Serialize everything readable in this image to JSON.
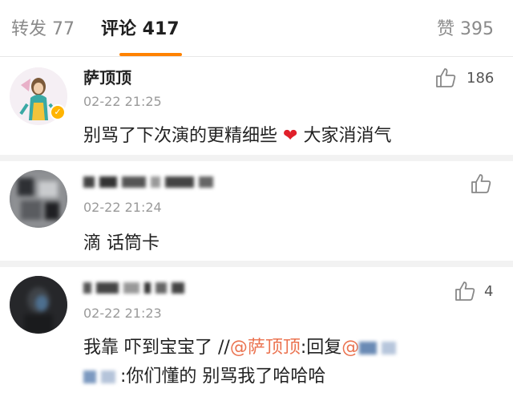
{
  "tabs": {
    "repost": "转发 77",
    "comments": "评论 417",
    "likes": "赞 395"
  },
  "comments": [
    {
      "username": "萨顶顶",
      "time": "02-22 21:25",
      "likes": "186",
      "text_before": "别骂了下次演的更精细些",
      "heart": "❤",
      "text_after": "大家消消气"
    },
    {
      "username": "",
      "time": "02-22 21:24",
      "likes": "",
      "text": "滴 话筒卡"
    },
    {
      "username": "",
      "time": "02-22 21:23",
      "likes": "4",
      "line1": "我靠  吓到宝宝了  //",
      "mention": "@萨顶顶",
      "reply_label": ":回复",
      "reply_at": "@",
      "line2": ":你们懂的 别骂我了哈哈哈"
    }
  ],
  "colors": {
    "accent": "#ff8200",
    "mention": "#eb7350",
    "heart": "#e0202a",
    "divider": "#f2f2f2"
  },
  "icons": {
    "like": "thumbs-up-icon",
    "verified": "verified-badge-icon"
  }
}
